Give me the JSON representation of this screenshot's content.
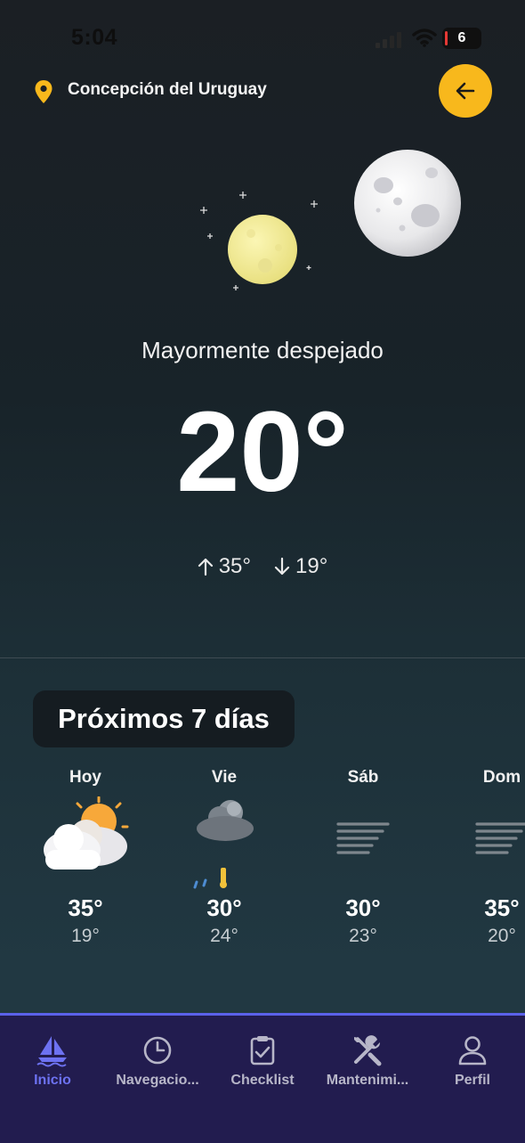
{
  "status_bar": {
    "time": "5:04",
    "battery": "6"
  },
  "header": {
    "location": "Concepción del Uruguay",
    "back_icon": "arrow-left-icon",
    "accent": "#f8b81c"
  },
  "current": {
    "condition": "Mayormente despejado",
    "temperature": "20°",
    "high": "35°",
    "low": "19°"
  },
  "forecast": {
    "title": "Próximos 7 días",
    "days": [
      {
        "name": "Hoy",
        "icon": "partly-cloudy-sun-icon",
        "high": "35°",
        "low": "19°"
      },
      {
        "name": "Vie",
        "icon": "rain-thunder-cloud-icon",
        "high": "30°",
        "low": "24°"
      },
      {
        "name": "Sáb",
        "icon": "fog-icon",
        "high": "30°",
        "low": "23°"
      },
      {
        "name": "Dom",
        "icon": "fog-icon",
        "high": "35°",
        "low": "20°"
      }
    ]
  },
  "tabs": [
    {
      "label": "Inicio",
      "icon": "sailboat-icon",
      "active": true
    },
    {
      "label": "Navegacio...",
      "icon": "clock-icon",
      "active": false
    },
    {
      "label": "Checklist",
      "icon": "clipboard-check-icon",
      "active": false
    },
    {
      "label": "Mantenimi...",
      "icon": "tools-icon",
      "active": false
    },
    {
      "label": "Perfil",
      "icon": "user-icon",
      "active": false
    }
  ]
}
